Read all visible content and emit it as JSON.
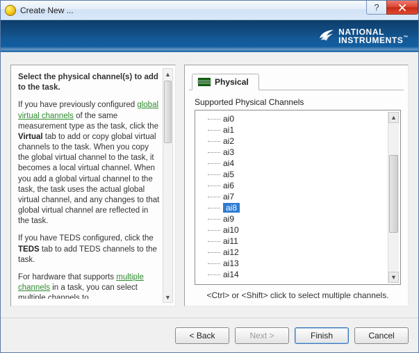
{
  "window": {
    "title": "Create New ..."
  },
  "titlebar_buttons": {
    "help": "?",
    "close": "X"
  },
  "branding": {
    "line1": "NATIONAL",
    "line2": "INSTRUMENTS",
    "trademark": "™"
  },
  "help": {
    "heading": "Select the physical channel(s) to add to the task.",
    "p1a": "If you have previously configured ",
    "link1": "global virtual channels",
    "p1b": " of the same measurement type as the task, click the ",
    "b1": "Virtual",
    "p1c": " tab to add or copy global virtual channels to the task. When you copy the global virtual channel to the task, it becomes a local virtual channel. When you add a global virtual channel to the task, the task uses the actual global virtual channel, and any changes to that global virtual channel are reflected in the task.",
    "p2a": "If you have TEDS configured, click the ",
    "b2": "TEDS",
    "p2b": " tab to add TEDS channels to the task.",
    "p3a": "For hardware that supports ",
    "link2": "multiple channels",
    "p3b": " in a task, you can select multiple channels to"
  },
  "tab": {
    "label": "Physical"
  },
  "channels": {
    "label": "Supported Physical Channels",
    "items": [
      "ai0",
      "ai1",
      "ai2",
      "ai3",
      "ai4",
      "ai5",
      "ai6",
      "ai7",
      "ai8",
      "ai9",
      "ai10",
      "ai11",
      "ai12",
      "ai13",
      "ai14"
    ],
    "selected_index": 8,
    "hint": "<Ctrl> or <Shift> click to select multiple channels."
  },
  "buttons": {
    "back": "< Back",
    "next": "Next >",
    "finish": "Finish",
    "cancel": "Cancel"
  }
}
